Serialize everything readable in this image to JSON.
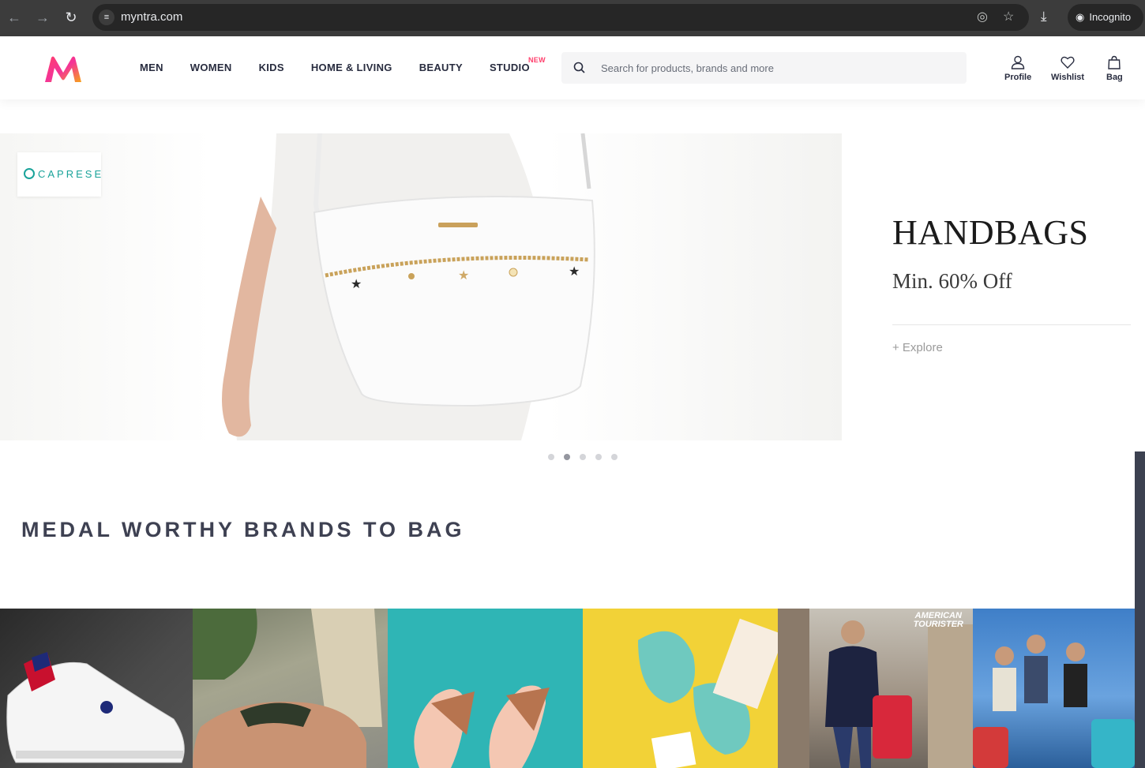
{
  "browser": {
    "url": "myntra.com",
    "incognito_label": "Incognito"
  },
  "header": {
    "nav": [
      {
        "label": "MEN"
      },
      {
        "label": "WOMEN"
      },
      {
        "label": "KIDS"
      },
      {
        "label": "HOME & LIVING"
      },
      {
        "label": "BEAUTY"
      },
      {
        "label": "STUDIO",
        "badge": "NEW"
      }
    ],
    "search_placeholder": "Search for products, brands and more",
    "actions": {
      "profile": "Profile",
      "wishlist": "Wishlist",
      "bag": "Bag"
    },
    "brand_colors": {
      "pink": "#ff3f6c",
      "orange": "#f59e0b",
      "magenta": "#e1219b"
    }
  },
  "banner": {
    "brand": "CAPRESE",
    "headline": "HANDBAGS",
    "offer": "Min. 60% Off",
    "cta": "+ Explore",
    "slides_total": 5,
    "active_slide": 2
  },
  "section": {
    "title": "MEDAL WORTHY BRANDS TO BAG"
  },
  "tiles": [
    {
      "name": "sneaker"
    },
    {
      "name": "casual-shoes"
    },
    {
      "name": "flats"
    },
    {
      "name": "mules"
    },
    {
      "name": "luggage-man",
      "logo_line1": "AMERICAN",
      "logo_line2": "TOURISTER"
    },
    {
      "name": "luggage-group"
    }
  ]
}
